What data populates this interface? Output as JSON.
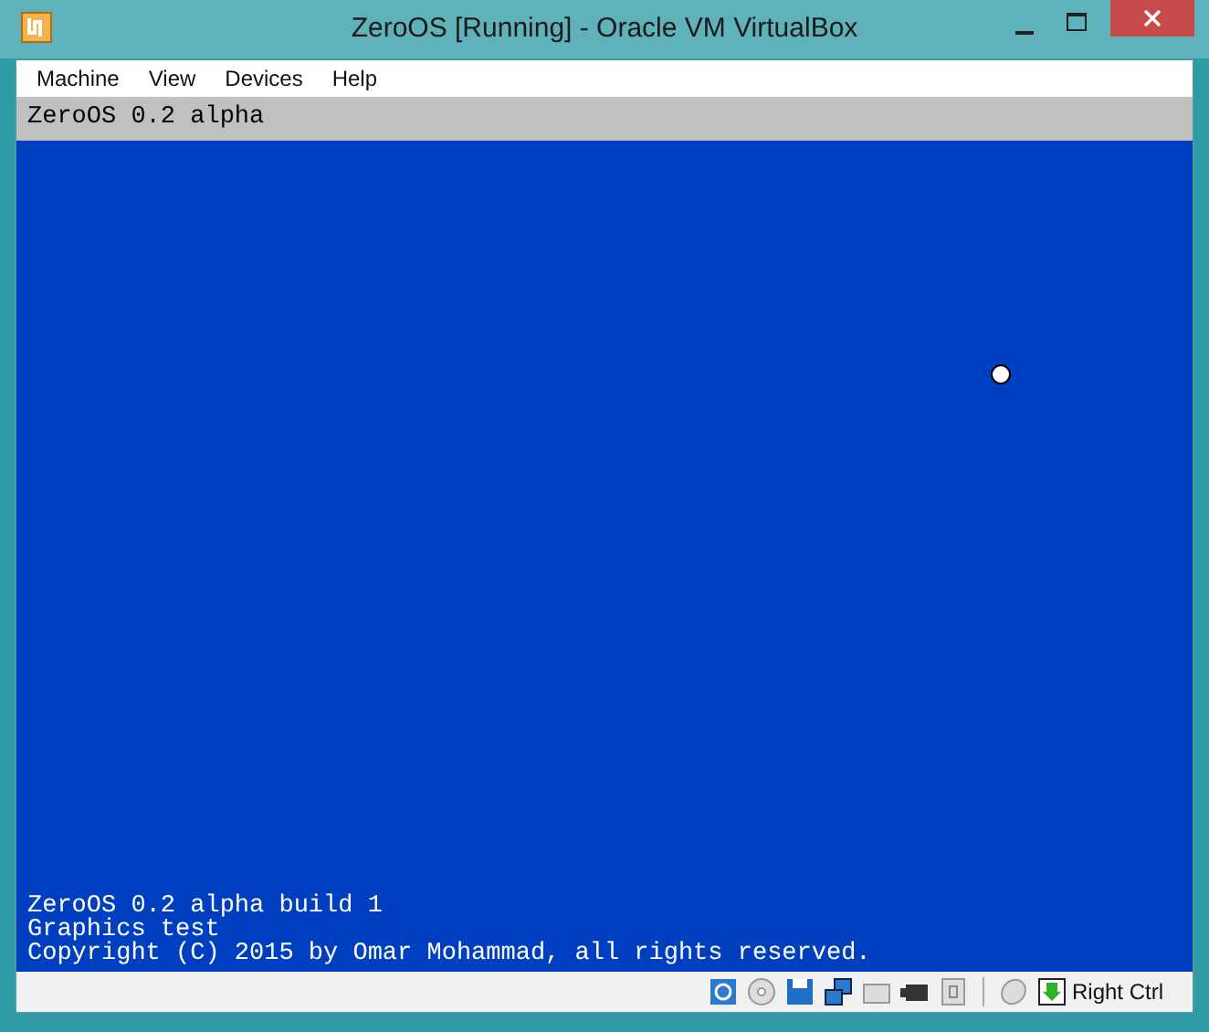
{
  "window": {
    "title": "ZeroOS [Running] - Oracle VM VirtualBox"
  },
  "menu": [
    "Machine",
    "View",
    "Devices",
    "Help"
  ],
  "vm_screen": {
    "header": "ZeroOS 0.2 alpha",
    "console_lines": [
      "ZeroOS 0.2 alpha build 1",
      "Graphics test",
      "Copyright (C) 2015 by Omar Mohammad, all rights reserved."
    ]
  },
  "status_bar": {
    "host_key": "Right Ctrl"
  }
}
